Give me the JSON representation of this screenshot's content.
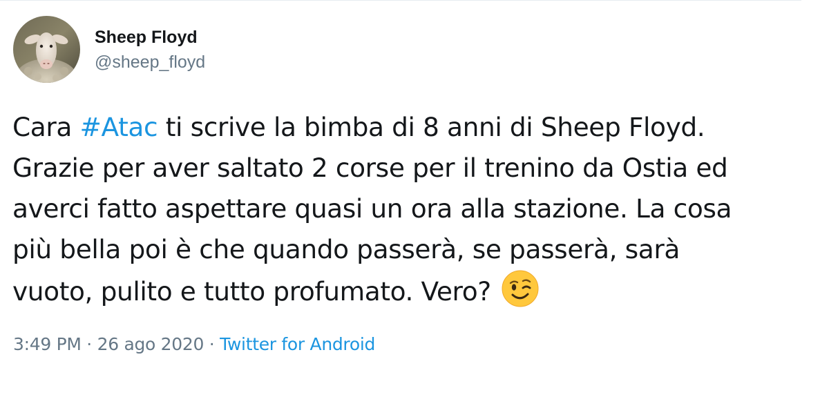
{
  "user": {
    "display_name": "Sheep Floyd",
    "handle": "@sheep_floyd",
    "avatar_icon": "sheep-avatar"
  },
  "tweet": {
    "lines": [
      {
        "before": "Cara ",
        "hashtag": "#Atac",
        "after": " ti scrive la bimba di 8 anni di Sheep Floyd."
      },
      {
        "text": "Grazie per aver saltato 2 corse per il trenino da Ostia ed"
      },
      {
        "text": "averci fatto aspettare quasi un ora alla stazione. La cosa"
      },
      {
        "text": "più bella poi è che quando passerà, se passerà, sarà"
      },
      {
        "text": "vuoto, pulito e tutto profumato. Vero? "
      }
    ],
    "emoji": "winking-face-emoji"
  },
  "meta": {
    "time": "3:49 PM",
    "separator": " · ",
    "date": "26 ago 2020",
    "source": "Twitter for Android"
  },
  "colors": {
    "link": "#1b95e0",
    "secondary_text": "#657786",
    "primary_text": "#14171a",
    "divider": "#e6ecf0",
    "emoji_fill": "#ffc83d"
  }
}
